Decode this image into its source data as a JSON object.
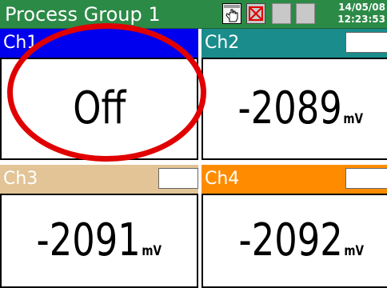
{
  "header": {
    "group_name": "Process Group 1",
    "date": "14/05/08",
    "time": "12:23:53",
    "icons": [
      "hand-pointer-icon",
      "alarm-muted-icon",
      "status-box",
      "status-box"
    ],
    "colors": {
      "background": "#2c8a47",
      "text": "#ffffff"
    }
  },
  "channels": [
    {
      "label": "Ch1",
      "value": "Off",
      "unit": "",
      "header_color": "#0000ee"
    },
    {
      "label": "Ch2",
      "value": "-2089",
      "unit": "mV",
      "header_color": "#1b8c8c"
    },
    {
      "label": "Ch3",
      "value": "-2091",
      "unit": "mV",
      "header_color": "#e2c497"
    },
    {
      "label": "Ch4",
      "value": "-2092",
      "unit": "mV",
      "header_color": "#ff8c00"
    }
  ],
  "annotation": {
    "shape": "ellipse",
    "color": "#e00000",
    "target": "Ch1"
  }
}
